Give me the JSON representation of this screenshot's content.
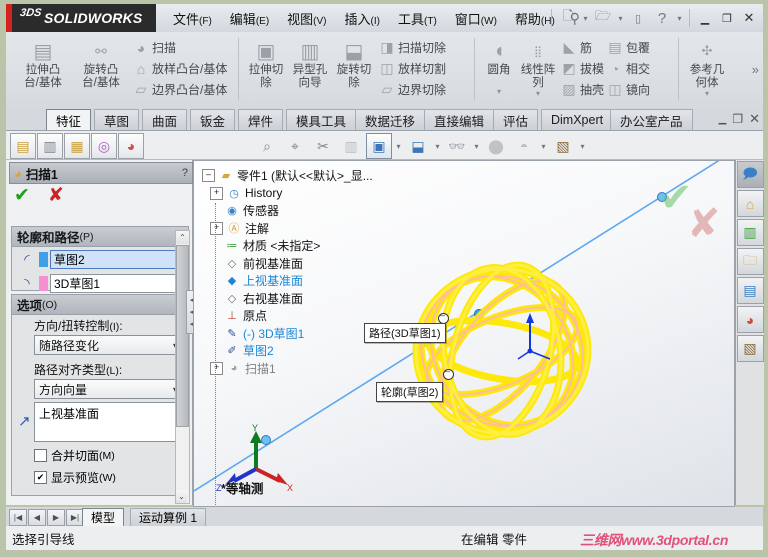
{
  "app": {
    "brand": "SOLIDWORKS",
    "brand_prefix": "3DS"
  },
  "menubar": {
    "items": [
      {
        "label": "文件",
        "mnemonic": "(F)"
      },
      {
        "label": "编辑",
        "mnemonic": "(E)"
      },
      {
        "label": "视图",
        "mnemonic": "(V)"
      },
      {
        "label": "插入",
        "mnemonic": "(I)"
      },
      {
        "label": "工具",
        "mnemonic": "(T)"
      },
      {
        "label": "窗口",
        "mnemonic": "(W)"
      },
      {
        "label": "帮助",
        "mnemonic": "(H)"
      }
    ],
    "pin_icon": "pin-icon",
    "quick_access": [
      "new-doc-icon",
      "open-folder-icon",
      "save-icon",
      "help-icon"
    ],
    "window_buttons": [
      "minimize",
      "restore",
      "close"
    ]
  },
  "ribbon": {
    "groups": [
      {
        "name": "features-boss",
        "big": [
          {
            "label_line1": "拉伸凸",
            "label_line2": "台/基体",
            "icon": "extrude-boss-icon"
          },
          {
            "label_line1": "旋转凸",
            "label_line2": "台/基体",
            "icon": "revolve-boss-icon"
          }
        ],
        "small": [
          {
            "label": "扫描",
            "icon": "sweep-icon"
          },
          {
            "label": "放样凸台/基体",
            "icon": "loft-boss-icon"
          },
          {
            "label": "边界凸台/基体",
            "icon": "boundary-boss-icon"
          }
        ]
      },
      {
        "name": "features-cut",
        "big": [
          {
            "label_line1": "拉伸切",
            "label_line2": "除",
            "icon": "extrude-cut-icon"
          },
          {
            "label_line1": "异型孔",
            "label_line2": "向导",
            "icon": "hole-wizard-icon"
          },
          {
            "label_line1": "旋转切",
            "label_line2": "除",
            "icon": "revolve-cut-icon"
          }
        ],
        "small": [
          {
            "label": "扫描切除",
            "icon": "sweep-cut-icon"
          },
          {
            "label": "放样切割",
            "icon": "loft-cut-icon"
          },
          {
            "label": "边界切除",
            "icon": "boundary-cut-icon"
          }
        ]
      },
      {
        "name": "features-modify",
        "big": [
          {
            "label_line1": "圆角",
            "label_line2": "",
            "icon": "fillet-icon",
            "has_caret": true
          },
          {
            "label_line1": "线性阵",
            "label_line2": "列",
            "icon": "linear-pattern-icon",
            "has_caret": true
          }
        ],
        "small": [
          {
            "label": "筋",
            "icon": "rib-icon"
          },
          {
            "label": "拔模",
            "icon": "draft-icon"
          },
          {
            "label": "抽壳",
            "icon": "shell-icon"
          }
        ],
        "small2": [
          {
            "label": "包覆",
            "icon": "wrap-icon"
          },
          {
            "label": "相交",
            "icon": "intersect-icon"
          },
          {
            "label": "镜向",
            "icon": "mirror-icon"
          }
        ]
      },
      {
        "name": "reference-geometry",
        "big": [
          {
            "label_line1": "参考几",
            "label_line2": "何体",
            "icon": "reference-geometry-icon",
            "has_caret": true
          }
        ],
        "small": []
      }
    ],
    "expand_icon": "chevron-double-right-icon"
  },
  "command_tabs": {
    "items": [
      "特征",
      "草图",
      "曲面",
      "钣金",
      "焊件",
      "模具工具",
      "数据迁移",
      "直接编辑",
      "评估",
      "DimXpert",
      "办公室产品"
    ],
    "active_index": 0,
    "window_buttons": [
      "minimize",
      "restore",
      "close"
    ]
  },
  "view_toolbar": {
    "left_icons": [
      "save-as-icon",
      "edit-properties-icon",
      "rebuild-icon",
      "options-icon",
      "appearance-icon"
    ],
    "mid_icons": [
      "zoom-to-fit-icon",
      "zoom-to-area-icon",
      "section-view-icon",
      "view-orientation-icon",
      "display-style-icon",
      "hide-show-icon",
      "edit-appearance-icon",
      "apply-scene-icon",
      "view-settings-icon"
    ]
  },
  "property_manager": {
    "title": "扫描1",
    "title_icon": "sweep-icon",
    "help_icon": "question-icon",
    "ok_label": "✔",
    "cancel_label": "✘",
    "sections": [
      {
        "title": "轮廓和路径",
        "mnemonic": "(P)",
        "collapse_icon": "chevron-up-icon",
        "fields": [
          {
            "icon": "profile-icon",
            "swatch": "#3f9fe8",
            "value": "草图2",
            "selected": true
          },
          {
            "icon": "path-icon",
            "swatch": "#f48fd0",
            "value": "3D草图1",
            "selected": false
          }
        ]
      },
      {
        "title": "选项",
        "mnemonic": "(O)",
        "collapse_icon": "chevron-up-icon",
        "label_orientation": "方向/扭转控制",
        "label_orientation_mn": "(I)",
        "combo_orientation": "随路径变化",
        "label_path_align": "路径对齐类型",
        "label_path_align_mn": "(L)",
        "combo_path_align": "方向向量",
        "direction_vector": "上视基准面",
        "checkbox_merge": "合并切面",
        "checkbox_merge_mn": "(M)",
        "checkbox_merge_checked": false,
        "checkbox_preview": "显示预览",
        "checkbox_preview_mn": "(W)",
        "checkbox_preview_checked": true
      }
    ]
  },
  "feature_tree": {
    "root": "零件1   (默认<<默认>_显...",
    "root_icon": "part-icon",
    "nodes": [
      {
        "label": "History",
        "icon": "history-icon",
        "expandable": true,
        "color": "normal"
      },
      {
        "label": "传感器",
        "icon": "sensor-icon",
        "expandable": false,
        "color": "normal"
      },
      {
        "label": "注解",
        "icon": "annotation-icon",
        "expandable": true,
        "color": "normal"
      },
      {
        "label": "材质 <未指定>",
        "icon": "material-icon",
        "expandable": false,
        "color": "normal"
      },
      {
        "label": "前视基准面",
        "icon": "plane-icon",
        "expandable": false,
        "color": "normal"
      },
      {
        "label": "上视基准面",
        "icon": "plane-selected-icon",
        "expandable": false,
        "color": "blue"
      },
      {
        "label": "右视基准面",
        "icon": "plane-icon",
        "expandable": false,
        "color": "normal"
      },
      {
        "label": "原点",
        "icon": "origin-icon",
        "expandable": false,
        "color": "normal"
      },
      {
        "label": "(-) 3D草图1",
        "icon": "sketch3d-icon",
        "expandable": false,
        "color": "blue"
      },
      {
        "label": "草图2",
        "icon": "sketch-icon",
        "expandable": false,
        "color": "blue"
      },
      {
        "label": "扫描1",
        "icon": "sweep-gray-icon",
        "expandable": true,
        "color": "gray"
      }
    ]
  },
  "graphics": {
    "callouts": [
      {
        "text": "路径(3D草图1)"
      },
      {
        "text": "轮廓(草图2)"
      }
    ],
    "view_label": "*等轴测",
    "confirm_ok": "✔",
    "confirm_cancel": "✘",
    "triad": {
      "x": "X",
      "y": "Y",
      "z": "Z"
    },
    "model_color": "#ffee00",
    "model_description": "yellow swept coil"
  },
  "task_pane": {
    "buttons": [
      "solidworks-resources-icon",
      "design-library-icon",
      "file-explorer-icon",
      "search-icon",
      "view-palette-icon",
      "appearances-scenes-icon",
      "custom-properties-icon"
    ],
    "active_index": 0
  },
  "bottom": {
    "nav_buttons": [
      "first-icon",
      "prev-icon",
      "next-icon",
      "last-icon"
    ],
    "tabs": [
      "模型",
      "运动算例 1"
    ],
    "active_tab_index": 0
  },
  "status_bar": {
    "message": "选择引导线",
    "edit_state": "在编辑 零件",
    "watermark": "三维网www.3dportal.cn"
  }
}
